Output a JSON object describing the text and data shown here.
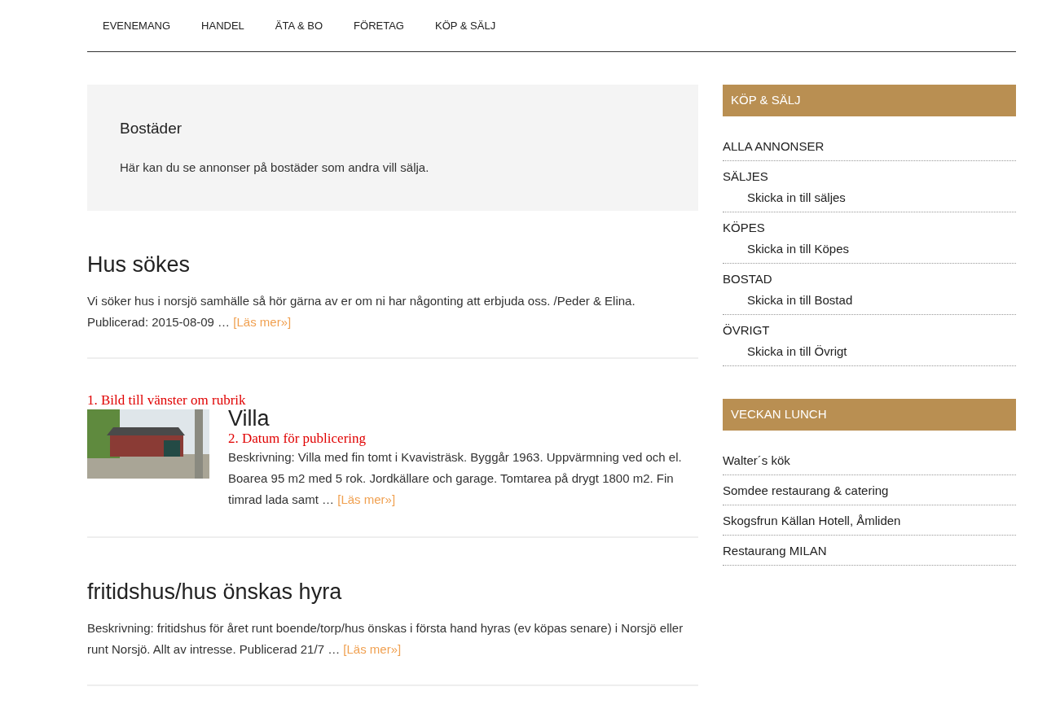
{
  "nav": [
    {
      "label": "EVENEMANG"
    },
    {
      "label": "HANDEL"
    },
    {
      "label": "ÄTA & BO"
    },
    {
      "label": "FÖRETAG"
    },
    {
      "label": "KÖP & SÄLJ"
    }
  ],
  "intro": {
    "title": "Bostäder",
    "text": "Här kan du se annonser på bostäder som andra vill sälja."
  },
  "posts": [
    {
      "kind": "text",
      "title": "Hus sökes",
      "text": "Vi söker hus i norsjö samhälle så hör gärna av er om ni har någonting att erbjuda oss. /Peder & Elina. Publicerad: 2015-08-09 …",
      "link": "[Läs mer»]"
    },
    {
      "kind": "image",
      "image_note": "1. Bild till vänster om rubrik",
      "title": "Villa",
      "date_note": "2. Datum för publicering",
      "text": "Beskrivning: Villa med fin tomt i Kvavisträsk. Byggår 1963. Uppvärmning ved och el. Boarea 95 m2 med 5 rok. Jordkällare och garage. Tomtarea på drygt 1800 m2. Fin timrad lada samt …",
      "link": "[Läs mer»]"
    },
    {
      "kind": "text",
      "title": "fritidshus/hus önskas hyra",
      "text": "Beskrivning: fritidshus för året runt boende/torp/hus önskas i första hand hyras (ev köpas senare) i Norsjö eller runt Norsjö. Allt av intresse. Publicerad 21/7 …",
      "link": "[Läs mer»]"
    }
  ],
  "sidebar": [
    {
      "title": "KÖP & SÄLJ",
      "items": [
        {
          "label": "ALLA ANNONSER"
        },
        {
          "label": "SÄLJES",
          "children": [
            {
              "label": "Skicka in till säljes"
            }
          ]
        },
        {
          "label": "KÖPES",
          "children": [
            {
              "label": "Skicka in till Köpes"
            }
          ]
        },
        {
          "label": "BOSTAD",
          "children": [
            {
              "label": "Skicka in till Bostad"
            }
          ]
        },
        {
          "label": "ÖVRIGT",
          "children": [
            {
              "label": "Skicka in till Övrigt"
            }
          ]
        }
      ]
    },
    {
      "title": "VECKAN LUNCH",
      "items": [
        {
          "label": "Walter´s kök"
        },
        {
          "label": "Somdee restaurang & catering"
        },
        {
          "label": "Skogsfrun Källan Hotell, Åmliden"
        },
        {
          "label": "Restaurang MILAN"
        }
      ]
    }
  ]
}
